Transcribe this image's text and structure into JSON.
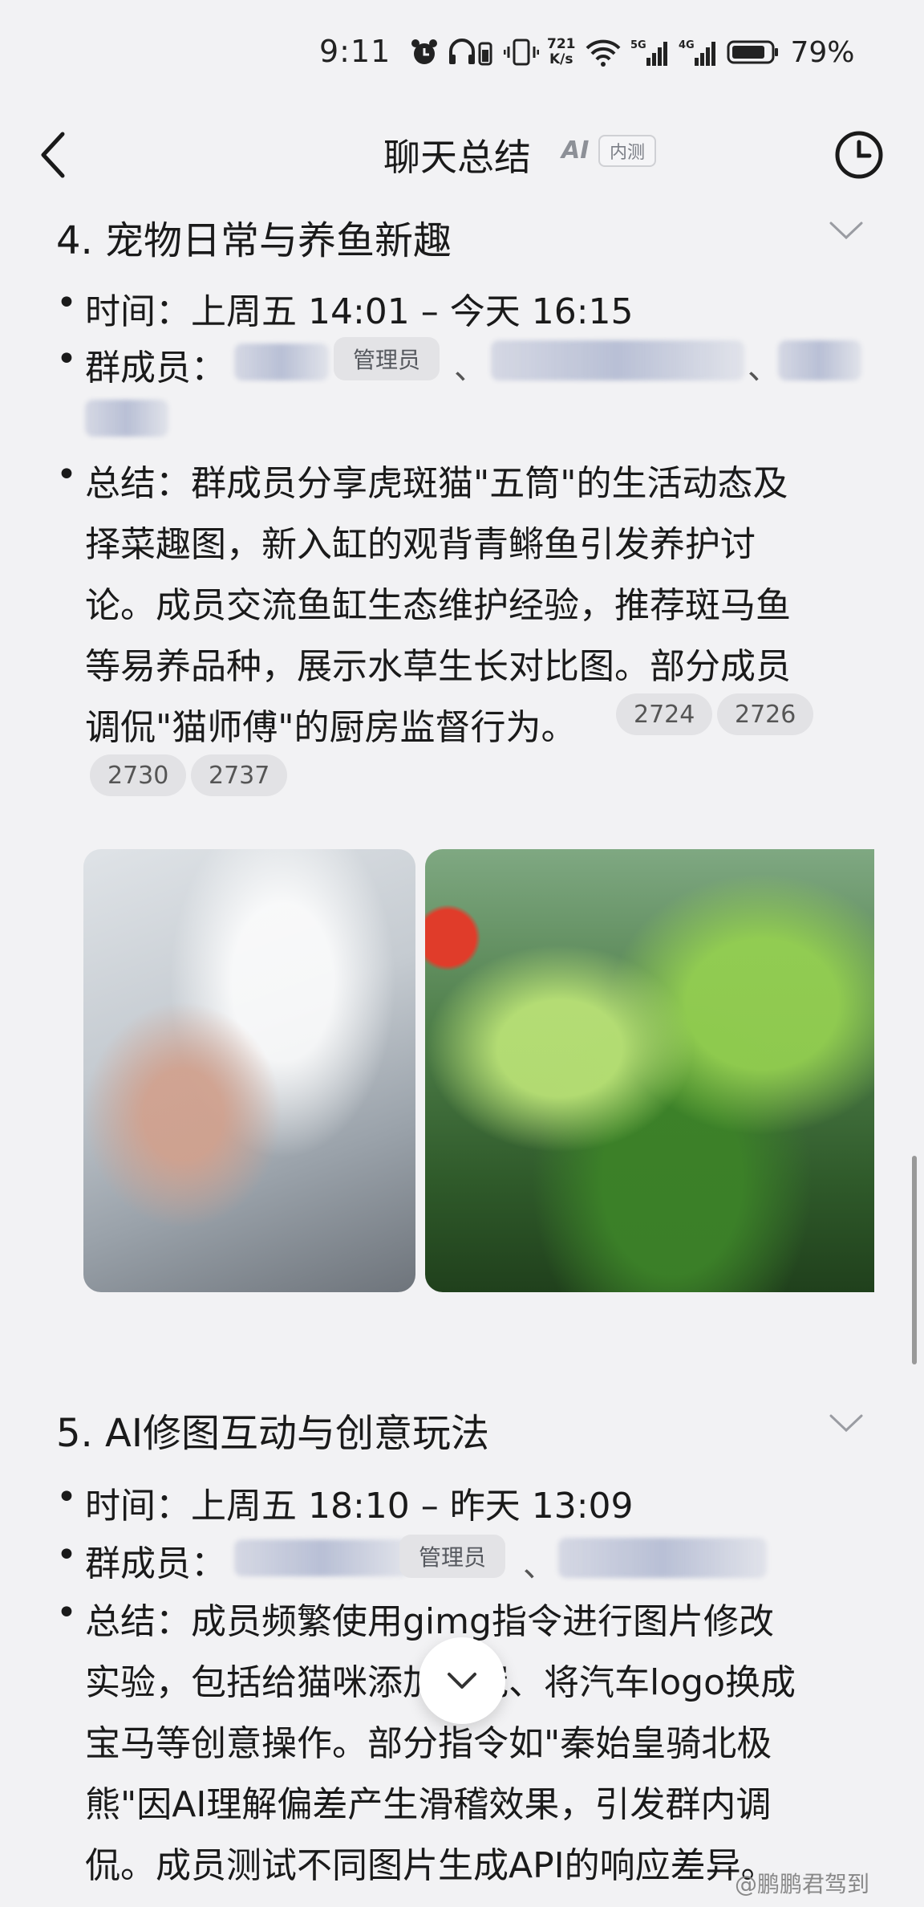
{
  "status_bar": {
    "time": "9:11",
    "net_speed_value": "721",
    "net_speed_unit": "K/s",
    "signal_5g": "5G",
    "signal_4g": "4G",
    "battery": "79%"
  },
  "header": {
    "title": "聊天总结",
    "ai_label": "AI",
    "badge": "内测"
  },
  "sections": [
    {
      "title": "4. 宠物日常与养鱼新趣",
      "time_line": "时间：上周五 14:01 – 今天 16:15",
      "members_label": "群成员：",
      "admin_tag": "管理员",
      "separator": "、",
      "summary_lines": [
        "总结：群成员分享虎斑猫\"五筒\"的生活动态及",
        "择菜趣图，新入缸的观背青鳉鱼引发养护讨",
        "论。成员交流鱼缸生态维护经验，推荐斑马鱼",
        "等易养品种，展示水草生长对比图。部分成员",
        "调侃\"猫师傅\"的厨房监督行为。"
      ],
      "refs": [
        "2724",
        "2726",
        "2730",
        "2737"
      ]
    },
    {
      "title": "5. AI修图互动与创意玩法",
      "time_line": "时间：上周五 18:10 – 昨天 13:09",
      "members_label": "群成员：",
      "admin_tag": "管理员",
      "separator": "、",
      "summary_lines": [
        "总结：成员频繁使用gimg指令进行图片修改",
        "实验，包括给猫咪添加皇冠、将汽车logo换成",
        "宝马等创意操作。部分指令如\"秦始皇骑北极",
        "熊\"因AI理解偏差产生滑稽效果，引发群内调",
        "侃。成员测试不同图片生成API的响应差异。"
      ]
    }
  ],
  "watermark": "@鹏鹏君驾到"
}
